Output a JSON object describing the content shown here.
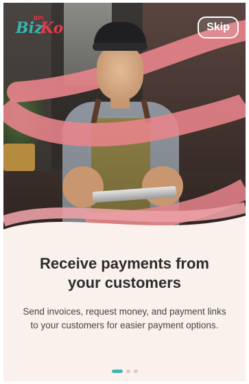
{
  "logo": {
    "bpi_text": "BPI",
    "biz_text": "Biz",
    "ko_text": "Ko"
  },
  "skip_label": "Skip",
  "onboarding": {
    "title_line1": "Receive payments from",
    "title_line2": "your customers",
    "description": "Send invoices, request money, and payment links to your customers for easier payment options."
  },
  "pagination": {
    "total": 3,
    "current": 1
  },
  "colors": {
    "teal": "#3fb6b2",
    "brand_red": "#e33b4a",
    "ribbon_pink": "#e8848b",
    "background": "#fbf1ec"
  }
}
